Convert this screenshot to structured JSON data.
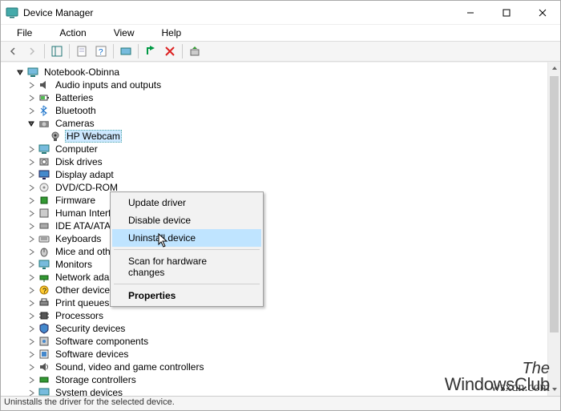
{
  "window": {
    "title": "Device Manager"
  },
  "menubar": {
    "file": "File",
    "action": "Action",
    "view": "View",
    "help": "Help"
  },
  "tree": {
    "root": "Notebook-Obinna",
    "nodes": [
      {
        "label": "Audio inputs and outputs"
      },
      {
        "label": "Batteries"
      },
      {
        "label": "Bluetooth"
      },
      {
        "label": "Cameras",
        "expanded": true,
        "child": "HP Webcam"
      },
      {
        "label": "Computer"
      },
      {
        "label": "Disk drives"
      },
      {
        "label": "Display adapt"
      },
      {
        "label": "DVD/CD-ROM"
      },
      {
        "label": "Firmware"
      },
      {
        "label": "Human Interf"
      },
      {
        "label": "IDE ATA/ATAP"
      },
      {
        "label": "Keyboards"
      },
      {
        "label": "Mice and other pointing devices"
      },
      {
        "label": "Monitors"
      },
      {
        "label": "Network adapters"
      },
      {
        "label": "Other devices"
      },
      {
        "label": "Print queues"
      },
      {
        "label": "Processors"
      },
      {
        "label": "Security devices"
      },
      {
        "label": "Software components"
      },
      {
        "label": "Software devices"
      },
      {
        "label": "Sound, video and game controllers"
      },
      {
        "label": "Storage controllers"
      },
      {
        "label": "System devices"
      }
    ]
  },
  "context_menu": {
    "items": {
      "update": "Update driver",
      "disable": "Disable device",
      "uninstall": "Uninstall device",
      "scan": "Scan for hardware changes",
      "properties": "Properties"
    }
  },
  "statusbar": {
    "text": "Uninstalls the driver for the selected device."
  },
  "watermark": {
    "line1": "The",
    "line2": "WindowsClub",
    "sub": "wsxdn.com"
  }
}
